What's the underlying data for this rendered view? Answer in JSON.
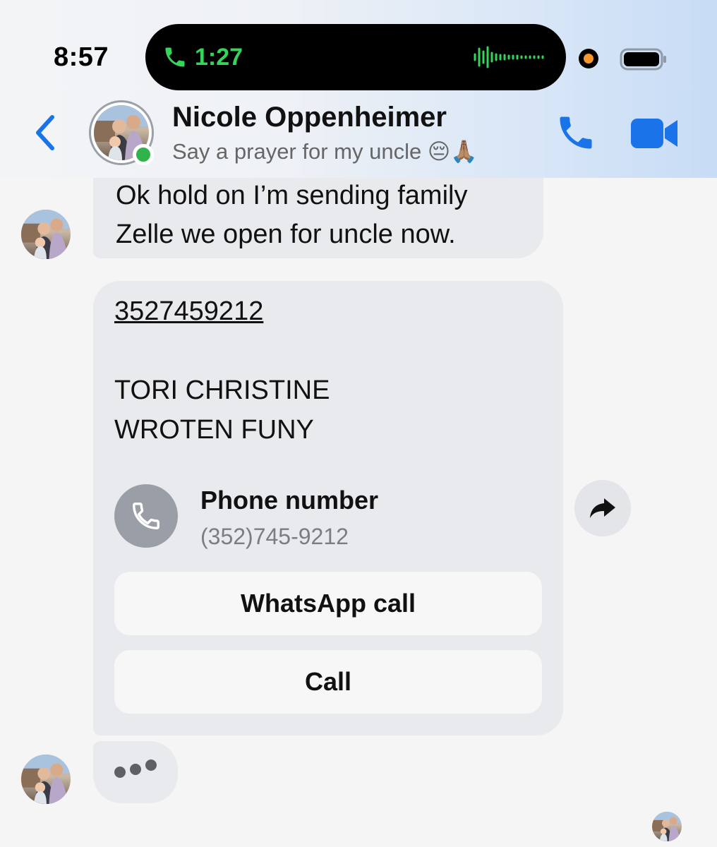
{
  "status_bar": {
    "time": "8:57",
    "call_duration": "1:27",
    "call_icon": "phone-icon",
    "accent_green": "#35d45a",
    "recording_dot_color": "#f7962b"
  },
  "header": {
    "back_icon": "chevron-left-icon",
    "contact_name": "Nicole Oppenheimer",
    "contact_status": "Say a prayer for my uncle 😔🙏🏽",
    "online": true,
    "audio_call_icon": "phone-icon",
    "video_call_icon": "video-camera-icon",
    "accent_color": "#1a73e8"
  },
  "messages": [
    {
      "type": "text",
      "lines": [
        "Ok hold on I’m sending family",
        "Zelle we open for uncle now."
      ]
    },
    {
      "type": "contact_card",
      "phone_link": "3527459212",
      "name_lines": [
        "TORI CHRISTINE",
        "WROTEN FUNY"
      ],
      "card_title": "Phone number",
      "card_number": "(352)745-9212",
      "buttons": [
        "WhatsApp call",
        "Call"
      ],
      "share_icon": "share-arrow-icon"
    },
    {
      "type": "typing_indicator"
    }
  ]
}
